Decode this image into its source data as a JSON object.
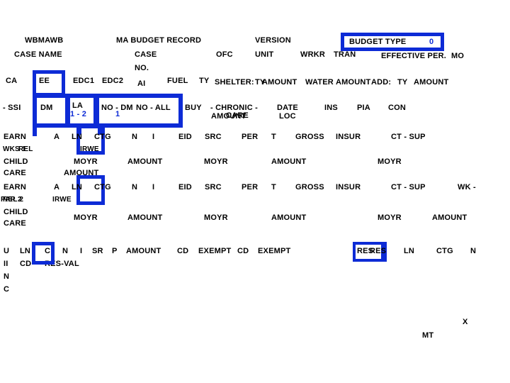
{
  "screen": {
    "title": "MA BUDGET RECORD",
    "background": "#ffffff",
    "accent": "#0d2bd6"
  },
  "header": {
    "wbmawb": "WBMAWB",
    "case_name": "CASE NAME",
    "record_title": "MA BUDGET RECORD",
    "case": "CASE",
    "case_no": "NO.",
    "ofc": "OFC",
    "version": "VERSION",
    "unit": "UNIT",
    "wrkr": "WRKR",
    "tran": "TRAN",
    "budget_type_label": "BUDGET TYPE",
    "budget_type_value": "0",
    "effective_per": "EFFECTIVE PER.",
    "mo": "MO"
  },
  "row_ca": {
    "ca": "CA",
    "ee": "EE",
    "edc1": "EDC1",
    "edc2": "EDC2",
    "ai": "AI",
    "fuel": "FUEL",
    "ty": "TY",
    "shelter": "SHELTER:",
    "shelter_ty": "TY",
    "amount": "AMOUNT",
    "water": "WATER",
    "water_amount": "AMOUNT",
    "add": "ADD:",
    "add_ty": "TY",
    "add_amount": "AMOUNT"
  },
  "row_ssi": {
    "ssi": "- SSI",
    "dm": "DM",
    "la": "LA",
    "la_range": "1 - 2",
    "no_dm": "NO - DM",
    "no_dm_val": "1",
    "no_all": "NO - ALL",
    "buy": "BUY",
    "chronic": "- CHRONIC -",
    "care": "CARE",
    "chronic_amount": "AMOUNT",
    "date": "DATE",
    "loc": "LOC",
    "ins": "INS",
    "pia": "PIA",
    "con": "CON"
  },
  "earn_block_1": {
    "earn": "EARN",
    "a": "A",
    "ln": "LN",
    "ctg": "CTG",
    "n": "N",
    "i": "I",
    "eid": "EID",
    "src": "SRC",
    "per": "PER",
    "t": "T",
    "gross": "GROSS",
    "insur": "INSUR",
    "ct_sup": "CT - SUP",
    "wks": "WKS 1",
    "rel": "REL",
    "irwe": "IRWE",
    "child": "CHILD",
    "care": "CARE",
    "moyr1": "MOYR",
    "amount1": "AMOUNT",
    "amount_label": "AMOUNT",
    "moyr2": "MOYR",
    "amount2": "AMOUNT",
    "moyr3": "MOYR"
  },
  "earn_block_2": {
    "earn": "EARN",
    "a": "A",
    "ln": "LN",
    "ctg": "CTG",
    "n": "N",
    "i": "I",
    "eid": "EID",
    "src": "SRC",
    "per": "PER",
    "t": "T",
    "gross": "GROSS",
    "insur": "INSUR",
    "ct_sup": "CT - SUP",
    "wk": "WK -",
    "rel2": "REL 2",
    "par2": "PAR 2",
    "irwe": "IRWE",
    "child": "CHILD",
    "care": "CARE",
    "moyr1": "MOYR",
    "amount1": "AMOUNT",
    "moyr2": "MOYR",
    "amount2": "AMOUNT",
    "moyr3": "MOYR",
    "amount3": "AMOUNT"
  },
  "unc_row": {
    "u": "U",
    "ii": "II",
    "n": "N",
    "c": "C",
    "ln": "LN",
    "cd": "CD",
    "c2": "C",
    "res_val": "RES-VAL",
    "n2": "N",
    "i": "I",
    "sr": "SR",
    "p": "P",
    "amount": "AMOUNT",
    "cd2": "CD",
    "exempt": "EXEMPT",
    "cd3": "CD",
    "exempt2": "EXEMPT",
    "res": "RES",
    "res_overlap": "RES",
    "ln2": "LN",
    "ctg": "CTG",
    "n3": "N"
  },
  "footer": {
    "x": "X",
    "mt": "MT"
  }
}
